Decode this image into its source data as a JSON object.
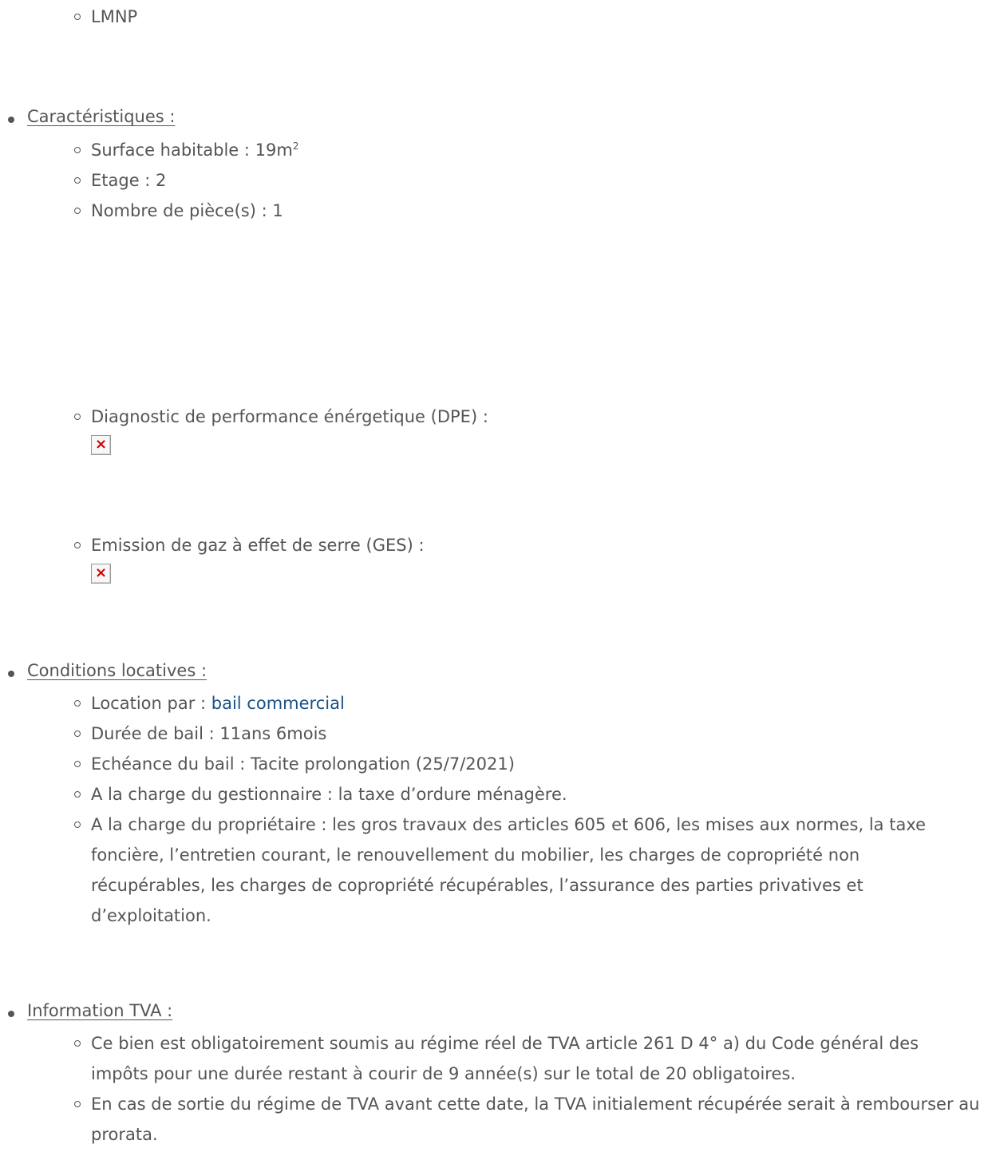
{
  "fiscalite": {
    "items": [
      "LMNP"
    ]
  },
  "caracteristiques": {
    "heading": "Caractéristiques :",
    "surface_label": "Surface habitable : 19m",
    "surface_sup": "2",
    "etage": "Etage : 2",
    "pieces": "Nombre de pièce(s) : 1",
    "dpe_label": "Diagnostic de performance énérgetique (DPE) :",
    "ges_label": "Emission de gaz à effet de serre (GES) :"
  },
  "conditions": {
    "heading": "Conditions locatives :",
    "location_label": "Location par : ",
    "location_link": "bail commercial",
    "duree": "Durée de bail : 11ans 6mois",
    "echeance": "Echéance du bail : Tacite prolongation (25/7/2021)",
    "gestionnaire": "A la charge du gestionnaire : la taxe d’ordure ménagère.",
    "proprietaire": "A la charge du propriétaire : les gros travaux des articles 605 et 606, les mises aux normes, la taxe foncière, l’entretien courant, le renouvellement du mobilier, les charges de copropriété non récupérables, les charges de copropriété récupérables, l’assurance des parties privatives et d’exploitation."
  },
  "tva": {
    "heading": "Information TVA :",
    "item1": "Ce bien est obligatoirement soumis au régime réel de TVA article 261 D 4° a) du Code général des impôts pour une durée restant à courir de 9 année(s) sur le total de 20 obligatoires.",
    "item2": "En cas de sortie du régime de TVA avant cette date, la TVA initialement récupérée serait à rembourser au prorata."
  }
}
